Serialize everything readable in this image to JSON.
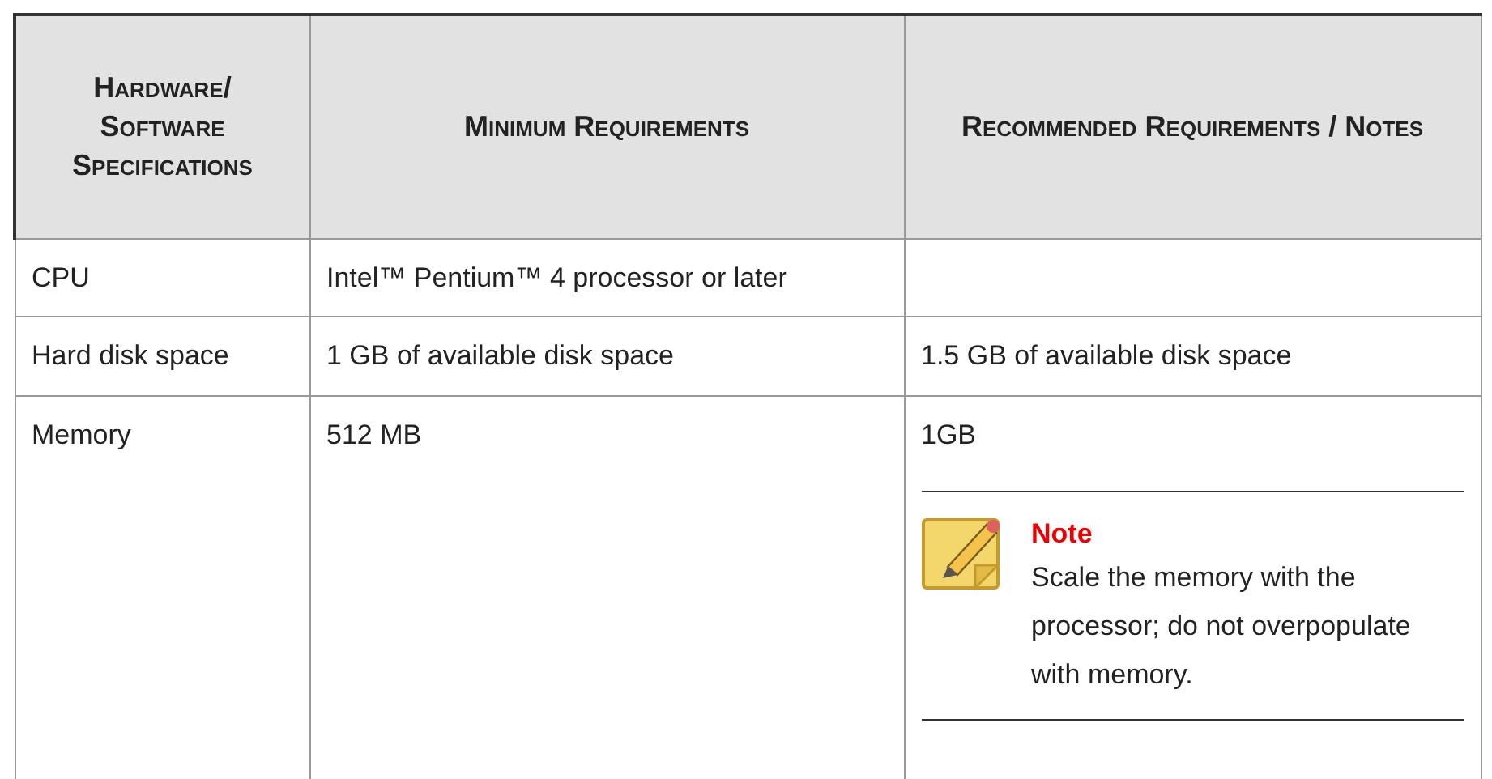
{
  "table": {
    "columns": [
      "Hardware/ Software Specifications",
      "Minimum Requirements",
      "Recommended Requirements / Notes"
    ],
    "rows": [
      {
        "cells": [
          "CPU",
          "Intel™ Pentium™ 4 processor or later",
          ""
        ]
      },
      {
        "cells": [
          "Hard disk space",
          "1 GB of available disk space",
          "1.5 GB of available disk space"
        ]
      },
      {
        "cells": [
          "Memory",
          "512 MB",
          "1GB"
        ],
        "note": {
          "title": "Note",
          "text": "Scale the memory with the processor; do not overpopulate with memory."
        }
      }
    ]
  }
}
